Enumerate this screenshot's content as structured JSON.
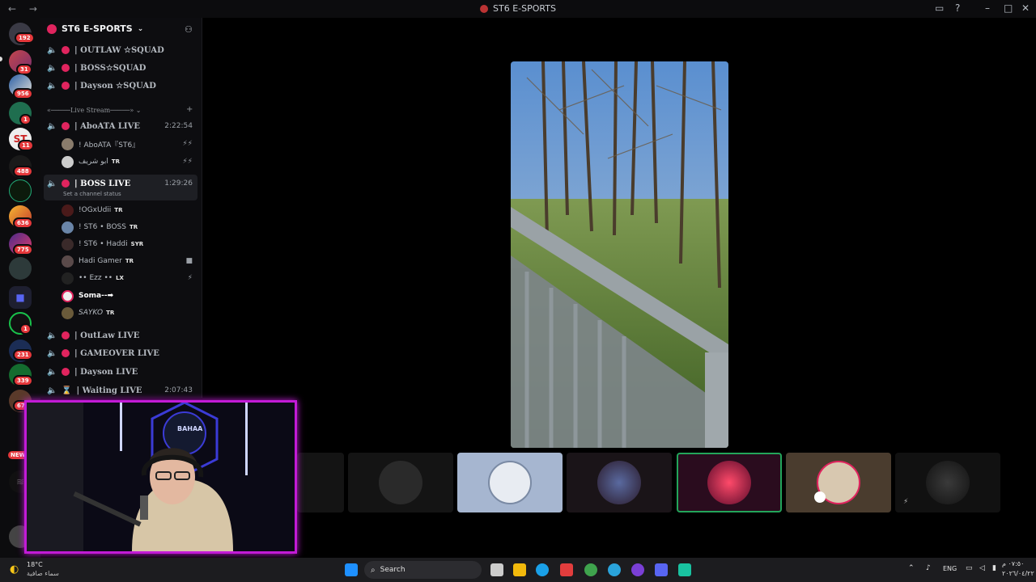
{
  "window": {
    "title": "ST6 E-SPORTS",
    "nav": "← →"
  },
  "servers": [
    {
      "name": "discord-home",
      "badge": "192"
    },
    {
      "name": "server-1",
      "badge": "31"
    },
    {
      "name": "server-2",
      "badge": "956"
    },
    {
      "name": "server-3",
      "badge": "1"
    },
    {
      "name": "server-st6",
      "badge": "11",
      "label": "ST"
    },
    {
      "name": "server-5",
      "badge": "488"
    },
    {
      "name": "server-esports",
      "badge": ""
    },
    {
      "name": "server-7",
      "badge": "636"
    },
    {
      "name": "server-8",
      "badge": "775"
    },
    {
      "name": "server-study",
      "badge": ""
    },
    {
      "name": "server-folder",
      "badge": ""
    },
    {
      "name": "server-11",
      "badge": "1"
    },
    {
      "name": "server-12",
      "badge": "231"
    },
    {
      "name": "server-13",
      "badge": "339"
    },
    {
      "name": "server-14",
      "badge": "67"
    },
    {
      "name": "server-new",
      "badge": "NEW"
    }
  ],
  "guild": {
    "name": "ST6 E-SPORTS"
  },
  "channels": {
    "top": [
      {
        "name": "| OUTLAW ☆SQUAD"
      },
      {
        "name": "| BOSS☆SQUAD"
      },
      {
        "name": "| Dayson ☆SQUAD"
      }
    ],
    "category": "«─────Live Stream─────»",
    "abo": {
      "name": "| AboATA LIVE",
      "time": "2:22:54"
    },
    "abo_users": [
      {
        "name": "! AboATA『ST6』",
        "tag": ""
      },
      {
        "name": "ابو شريف",
        "tag": "TR"
      }
    ],
    "boss": {
      "name": "| BOSS LIVE",
      "time": "1:29:26",
      "status": "Set a channel status"
    },
    "boss_users": [
      {
        "name": "!OGxUdii",
        "tag": "TR"
      },
      {
        "name": "! ST6 • BOSS",
        "tag": "TR"
      },
      {
        "name": "! ST6 • Haddi",
        "tag": "SYR"
      },
      {
        "name": "Hadi Gamer",
        "tag": "TR"
      },
      {
        "name": "•• Ezz ••",
        "tag": "LX"
      },
      {
        "name": "Soma--➡",
        "tag": ""
      },
      {
        "name": "SAYKO",
        "tag": "TR"
      }
    ],
    "bottom": [
      {
        "name": "| OutLaw LIVE",
        "time": ""
      },
      {
        "name": "| GAMEOVER LIVE",
        "time": ""
      },
      {
        "name": "| Dayson LIVE",
        "time": ""
      },
      {
        "name": "| Waiting LIVE",
        "time": "2:07:43"
      }
    ]
  },
  "webcam": {
    "sign": "BAHAA"
  },
  "taskbar": {
    "weather_temp": "18°C",
    "weather_desc": "سماء صافية",
    "search_placeholder": "Search",
    "lang": "ENG",
    "time": "٠٧:٥٠ م",
    "date": "٢٠٢٦/٠٤/٢٢"
  },
  "colors": {
    "accent": "#c21bd6",
    "live_dot": "#e0245e",
    "badge": "#e5383b"
  }
}
